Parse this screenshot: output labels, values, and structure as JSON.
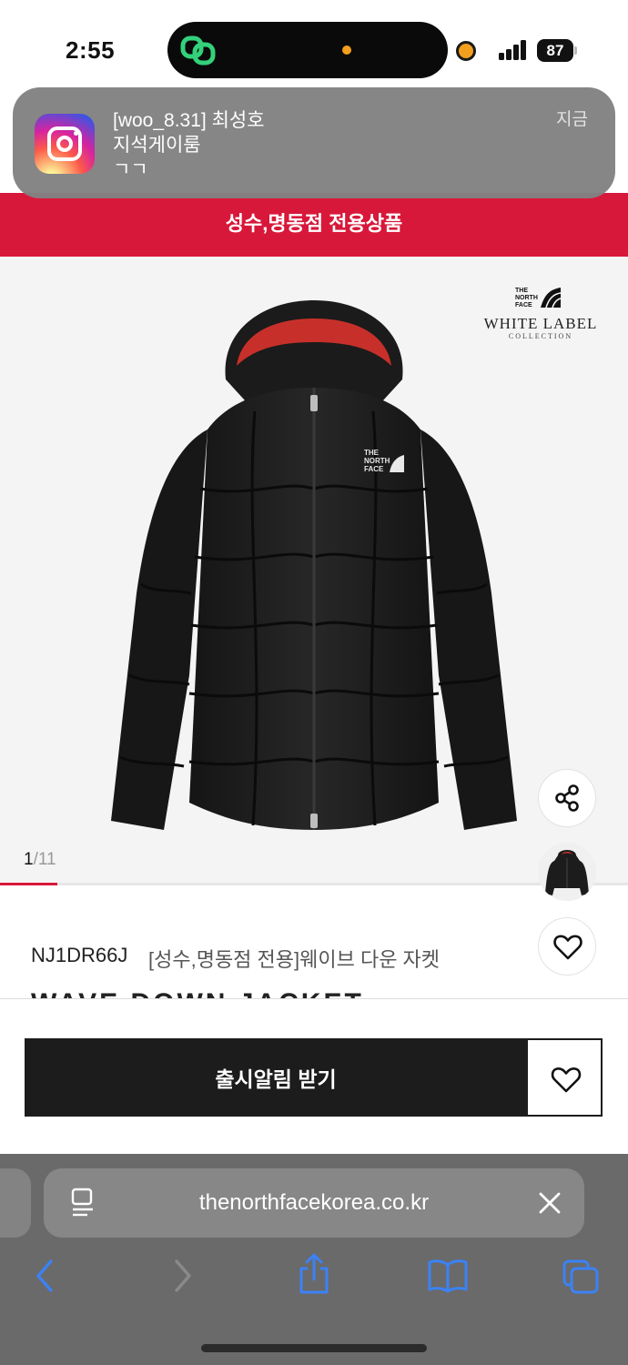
{
  "status_bar": {
    "time": "2:55",
    "battery_level": "87",
    "accent_color": "#f29f1e"
  },
  "notification": {
    "app_icon": "instagram-icon",
    "title": "[woo_8.31] 최성호",
    "subtitle": "지석게이룸",
    "body": "ㄱㄱ",
    "time": "지금"
  },
  "banner": {
    "text": "성수,명동점 전용상품",
    "color": "#d8183a"
  },
  "gallery": {
    "current": "1",
    "total": "/11",
    "progress": 0.0909,
    "brand_logo": "THE NORTH FACE",
    "collection_title": "WHITE LABEL",
    "collection_sub": "COLLECTION"
  },
  "product": {
    "code": "NJ1DR66J",
    "name": "[성수,명동점 전용]웨이브 다운 자켓",
    "english_name": "WAVE DOWN JACKET"
  },
  "actions": {
    "notify_label": "출시알림 받기"
  },
  "browser": {
    "url": "thenorthfacekorea.co.kr"
  }
}
